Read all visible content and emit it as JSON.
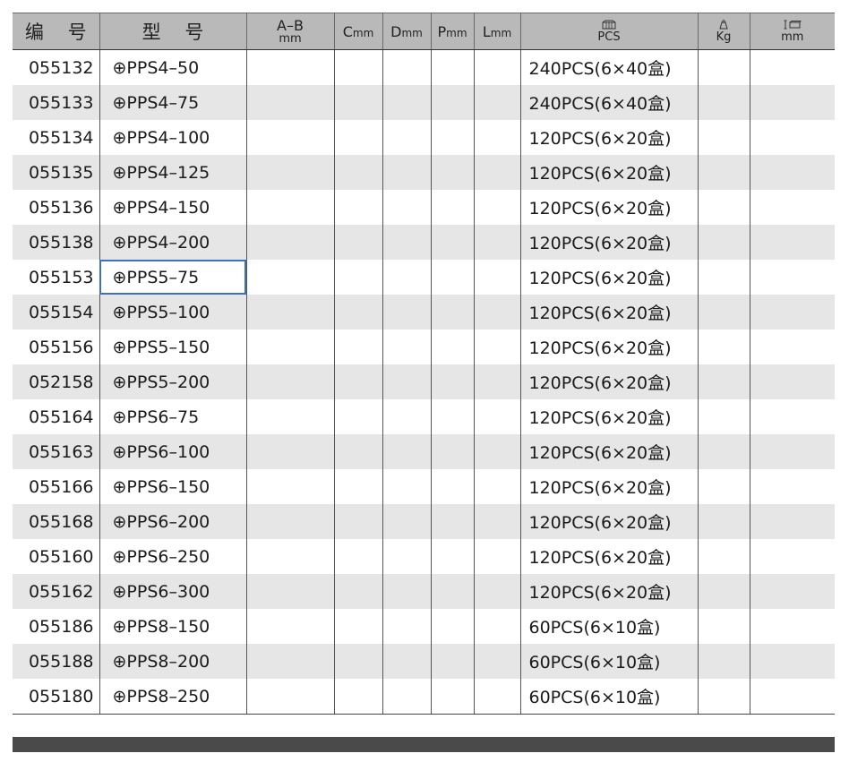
{
  "header": {
    "code": "编 号",
    "model": "型 号",
    "ab_top": "A–B",
    "ab_sub": "mm",
    "c_letter": "C",
    "c_unit": "mm",
    "d_letter": "D",
    "d_unit": "mm",
    "p_letter": "P",
    "p_unit": "mm",
    "l_letter": "L",
    "l_unit": "mm",
    "pack_sub": "PCS",
    "weight_sub": "Kg",
    "size_sub": "mm",
    "icons": [
      "box-icon",
      "weight-icon",
      "dimension-icon"
    ]
  },
  "rows": [
    {
      "code": "055132",
      "model": "⊕PPS4–50",
      "pack": "240PCS(6×40盒)"
    },
    {
      "code": "055133",
      "model": "⊕PPS4–75",
      "pack": "240PCS(6×40盒)"
    },
    {
      "code": "055134",
      "model": "⊕PPS4–100",
      "pack": "120PCS(6×20盒)"
    },
    {
      "code": "055135",
      "model": "⊕PPS4–125",
      "pack": "120PCS(6×20盒)"
    },
    {
      "code": "055136",
      "model": "⊕PPS4–150",
      "pack": "120PCS(6×20盒)"
    },
    {
      "code": "055138",
      "model": "⊕PPS4–200",
      "pack": "120PCS(6×20盒)"
    },
    {
      "code": "055153",
      "model": "⊕PPS5–75",
      "pack": "120PCS(6×20盒)"
    },
    {
      "code": "055154",
      "model": "⊕PPS5–100",
      "pack": "120PCS(6×20盒)"
    },
    {
      "code": "055156",
      "model": "⊕PPS5–150",
      "pack": "120PCS(6×20盒)"
    },
    {
      "code": "052158",
      "model": "⊕PPS5–200",
      "pack": "120PCS(6×20盒)"
    },
    {
      "code": "055164",
      "model": "⊕PPS6–75",
      "pack": "120PCS(6×20盒)"
    },
    {
      "code": "055163",
      "model": "⊕PPS6–100",
      "pack": "120PCS(6×20盒)"
    },
    {
      "code": "055166",
      "model": "⊕PPS6–150",
      "pack": "120PCS(6×20盒)"
    },
    {
      "code": "055168",
      "model": "⊕PPS6–200",
      "pack": "120PCS(6×20盒)"
    },
    {
      "code": "055160",
      "model": "⊕PPS6–250",
      "pack": "120PCS(6×20盒)"
    },
    {
      "code": "055162",
      "model": "⊕PPS6–300",
      "pack": "120PCS(6×20盒)"
    },
    {
      "code": "055186",
      "model": "⊕PPS8–150",
      "pack": "60PCS(6×10盒)"
    },
    {
      "code": "055188",
      "model": "⊕PPS8–200",
      "pack": "60PCS(6×10盒)"
    },
    {
      "code": "055180",
      "model": "⊕PPS8–250",
      "pack": "60PCS(6×10盒)"
    }
  ],
  "highlight_row_index": 6,
  "colors": {
    "header_bg": "#b9b9b9",
    "stripe_bg": "#e6e6e6",
    "highlight_border": "#3f6fc4",
    "bottom_bar": "#4a4a4a"
  }
}
